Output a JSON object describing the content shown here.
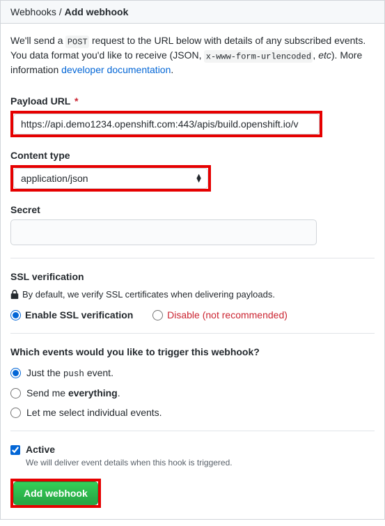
{
  "header": {
    "breadcrumb_root": "Webhooks",
    "breadcrumb_current": "Add webhook"
  },
  "intro": {
    "part1": "We'll send a ",
    "code1": "POST",
    "part2": " request to the URL below with details of any subscribed events. You data format you'd like to receive (JSON, ",
    "code2": "x-www-form-urlencoded",
    "part3": ", ",
    "etc": "etc",
    "part4": "). More information ",
    "link": "developer documentation",
    "part5": "."
  },
  "payload_url": {
    "label": "Payload URL",
    "value": "https://api.demo1234.openshift.com:443/apis/build.openshift.io/v"
  },
  "content_type": {
    "label": "Content type",
    "selected": "application/json"
  },
  "secret": {
    "label": "Secret"
  },
  "ssl": {
    "title": "SSL verification",
    "default_text": "By default, we verify SSL certificates when delivering payloads.",
    "enable_label": "Enable SSL verification",
    "disable_prefix": "Disable",
    "disable_note": " (not recommended)"
  },
  "events": {
    "title": "Which events would you like to trigger this webhook?",
    "just_push_prefix": "Just the ",
    "just_push_code": "push",
    "just_push_suffix": " event.",
    "everything_prefix": "Send me ",
    "everything_bold": "everything",
    "everything_suffix": ".",
    "individual": "Let me select individual events."
  },
  "active": {
    "label": "Active",
    "desc": "We will deliver event details when this hook is triggered."
  },
  "submit": {
    "label": "Add webhook"
  }
}
